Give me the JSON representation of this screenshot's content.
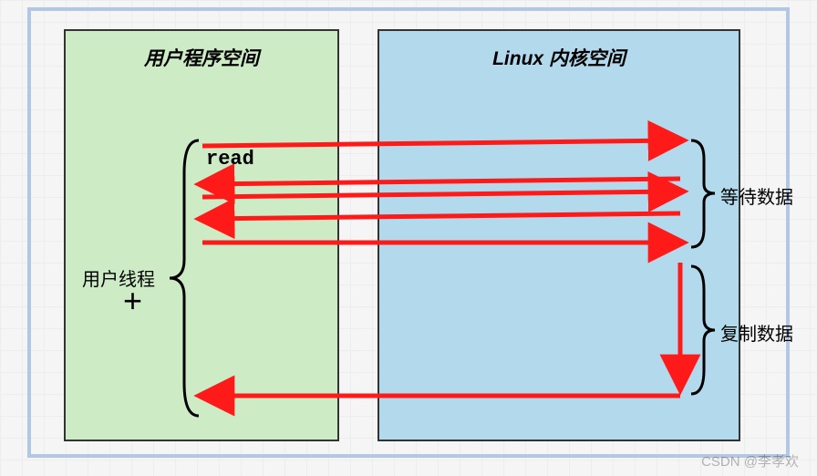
{
  "diagram": {
    "user_space_title": "用户程序空间",
    "kernel_space_title": "Linux 内核空间",
    "read_label": "read",
    "user_thread_label": "用户线程",
    "wait_data_label": "等待数据",
    "copy_data_label": "复制数据"
  },
  "watermark": "CSDN @李孝欢",
  "colors": {
    "user_box": "#cdebc4",
    "kernel_box": "#b3d9ed",
    "outer_border": "#b4c7e2",
    "arrow": "#ff1a1a"
  }
}
